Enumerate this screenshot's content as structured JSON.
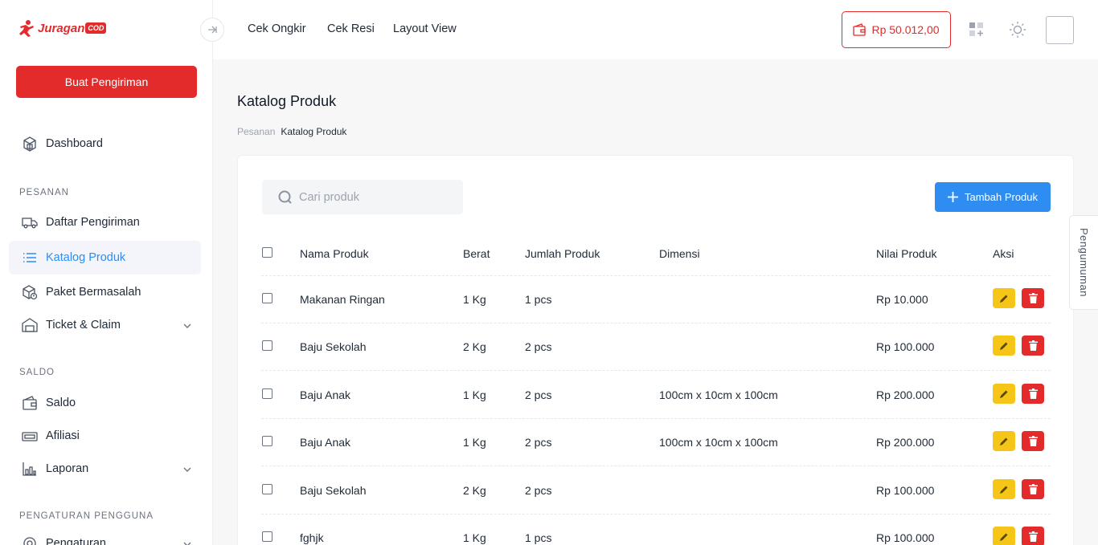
{
  "brand": {
    "name": "Juragan",
    "badge": "COD"
  },
  "sidebar": {
    "create_button": "Buat Pengiriman",
    "dashboard": "Dashboard",
    "sections": {
      "pesanan": "PESANAN",
      "saldo": "SALDO",
      "pengaturan": "PENGATURAN PENGGUNA"
    },
    "items": {
      "daftar_pengiriman": "Daftar Pengiriman",
      "katalog_produk": "Katalog Produk",
      "paket_bermasalah": "Paket Bermasalah",
      "ticket_claim": "Ticket & Claim",
      "saldo": "Saldo",
      "afiliasi": "Afiliasi",
      "laporan": "Laporan",
      "pengaturan": "Pengaturan"
    }
  },
  "topbar": {
    "links": [
      "Cek Ongkir",
      "Cek Resi",
      "Layout View"
    ],
    "balance": "Rp 50.012,00"
  },
  "page": {
    "title": "Katalog Produk",
    "breadcrumb": [
      "Pesanan",
      "Katalog Produk"
    ]
  },
  "search": {
    "placeholder": "Cari produk"
  },
  "add_button": "Tambah Produk",
  "table": {
    "headers": [
      "Nama Produk",
      "Berat",
      "Jumlah Produk",
      "Dimensi",
      "Nilai Produk",
      "Aksi"
    ],
    "rows": [
      {
        "name": "Makanan Ringan",
        "weight": "1 Kg",
        "qty": "1 pcs",
        "dimension": "",
        "value": "Rp 10.000"
      },
      {
        "name": "Baju Sekolah",
        "weight": "2 Kg",
        "qty": "2 pcs",
        "dimension": "",
        "value": "Rp 100.000"
      },
      {
        "name": "Baju Anak",
        "weight": "1 Kg",
        "qty": "2 pcs",
        "dimension": "100cm x 10cm x 100cm",
        "value": "Rp 200.000"
      },
      {
        "name": "Baju Anak",
        "weight": "1 Kg",
        "qty": "2 pcs",
        "dimension": "100cm x 10cm x 100cm",
        "value": "Rp 200.000"
      },
      {
        "name": "Baju Sekolah",
        "weight": "2 Kg",
        "qty": "2 pcs",
        "dimension": "",
        "value": "Rp 100.000"
      },
      {
        "name": "fghjk",
        "weight": "1 Kg",
        "qty": "1 pcs",
        "dimension": "",
        "value": "Rp 100.000"
      }
    ]
  },
  "announcement_tab": "Pengumuman",
  "colors": {
    "brand_red": "#e32b2b",
    "accent_blue": "#2f8cf0",
    "edit_yellow": "#f5c518"
  }
}
